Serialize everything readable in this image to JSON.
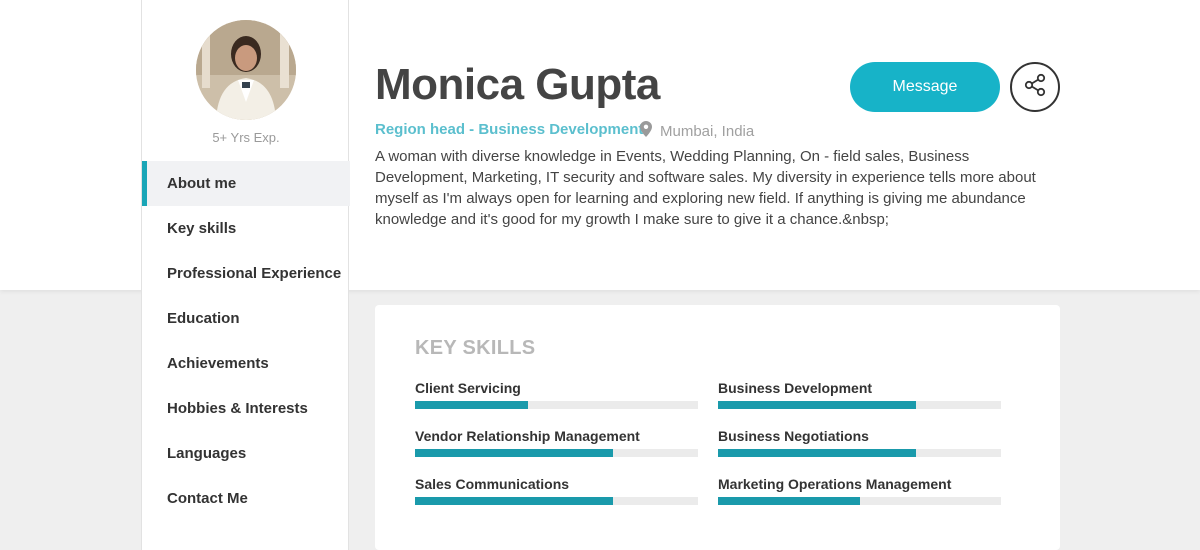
{
  "profile": {
    "name": "Monica Gupta",
    "role": "Region head - Business Development",
    "location": "Mumbai, India",
    "experience": "5+ Yrs Exp.",
    "about": "A woman with diverse knowledge in Events, Wedding Planning, On - field sales, Business Development, Marketing, IT security and software sales. My diversity in experience tells more about myself as I'm always open for learning and exploring new field. If anything is giving me abundance knowledge and it's good for my growth I make sure to give it a chance.&nbsp;"
  },
  "actions": {
    "message_label": "Message",
    "share_icon": "share-icon"
  },
  "nav": {
    "items": [
      {
        "label": "About me",
        "active": true
      },
      {
        "label": "Key skills",
        "active": false
      },
      {
        "label": "Professional Experience",
        "active": false
      },
      {
        "label": "Education",
        "active": false
      },
      {
        "label": "Achievements",
        "active": false
      },
      {
        "label": "Hobbies & Interests",
        "active": false
      },
      {
        "label": "Languages",
        "active": false
      },
      {
        "label": "Contact Me",
        "active": false
      }
    ]
  },
  "skills": {
    "title": "KEY SKILLS",
    "items": [
      {
        "label": "Client Servicing",
        "level": 0.4
      },
      {
        "label": "Business Development",
        "level": 0.7
      },
      {
        "label": "Vendor Relationship Management",
        "level": 0.7
      },
      {
        "label": "Business Negotiations",
        "level": 0.7
      },
      {
        "label": "Sales Communications",
        "level": 0.7
      },
      {
        "label": "Marketing Operations Management",
        "level": 0.5
      }
    ]
  },
  "colors": {
    "accent": "#1aa6b7",
    "button": "#17b3c8",
    "role_text": "#5bbfce",
    "skill_fill": "#1a9aab"
  }
}
